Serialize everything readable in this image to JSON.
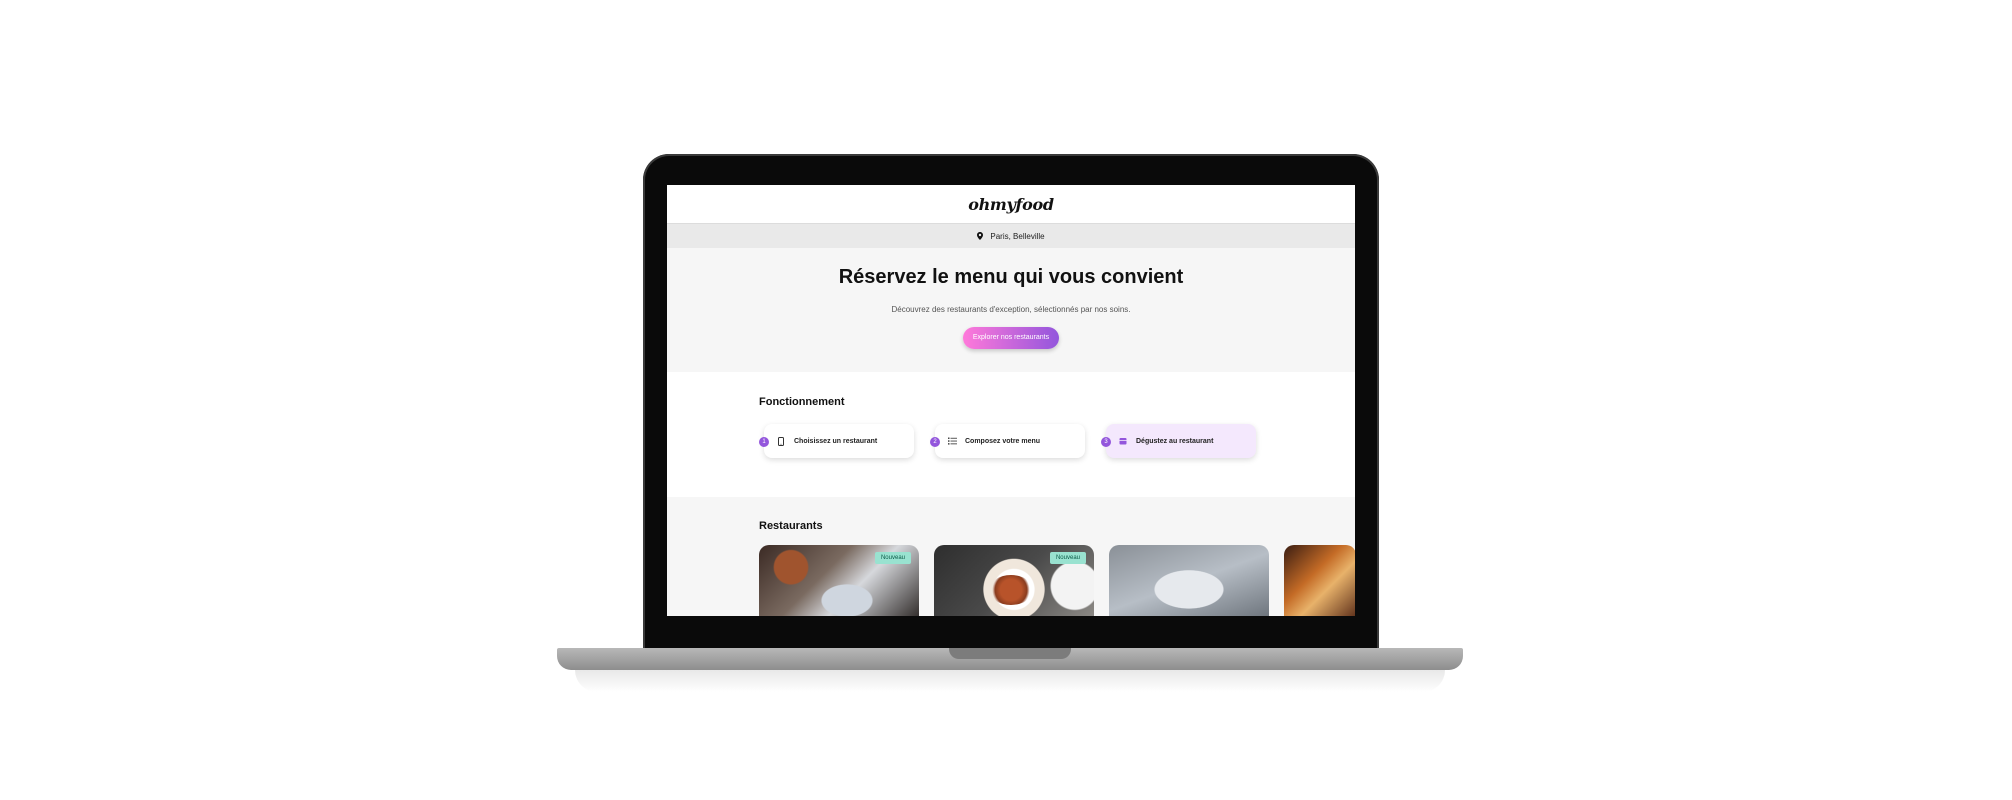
{
  "site": {
    "logo": "ohmyfood",
    "location": "Paris, Belleville"
  },
  "hero": {
    "title": "Réservez le menu qui vous convient",
    "subtitle": "Découvrez des restaurants d'exception, sélectionnés par nos soins.",
    "cta": "Explorer nos restaurants"
  },
  "how": {
    "title": "Fonctionnement",
    "steps": [
      {
        "number": "1",
        "label": "Choisissez un restaurant",
        "icon": "mobile-phone-icon"
      },
      {
        "number": "2",
        "label": "Composez votre menu",
        "icon": "list-icon"
      },
      {
        "number": "3",
        "label": "Dégustez au restaurant",
        "icon": "calendar-icon"
      }
    ]
  },
  "restaurants": {
    "title": "Restaurants",
    "badge": "Nouveau"
  },
  "colors": {
    "accent_pink": "#ff79da",
    "accent_purple": "#9356dc",
    "badge_green": "#99e2d0"
  }
}
